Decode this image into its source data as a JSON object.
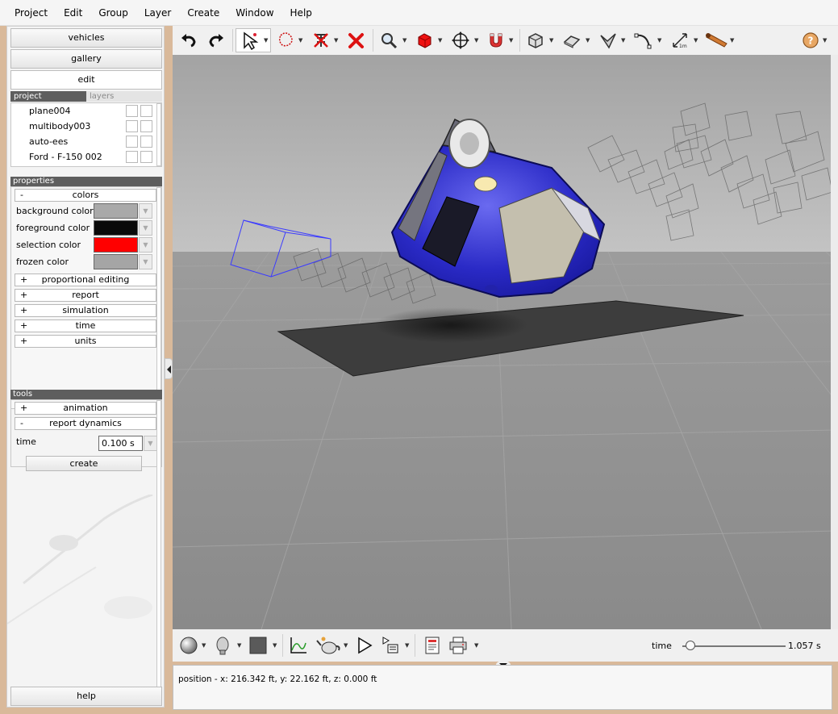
{
  "menu": [
    "Project",
    "Edit",
    "Group",
    "Layer",
    "Create",
    "Window",
    "Help"
  ],
  "nav": {
    "vehicles": "vehicles",
    "gallery": "gallery",
    "edit": "edit",
    "help": "help"
  },
  "project_panel": {
    "tabs": [
      "project",
      "layers"
    ],
    "items": [
      "plane004",
      "multibody003",
      "auto-ees",
      "Ford - F-150 002"
    ]
  },
  "properties": {
    "title": "properties",
    "colors_section": "colors",
    "colors": [
      {
        "label": "background color",
        "color": "#a9a9a9"
      },
      {
        "label": "foreground color",
        "color": "#0a0a0a"
      },
      {
        "label": "selection color",
        "color": "#ff0000"
      },
      {
        "label": "frozen color",
        "color": "#a5a5a5"
      }
    ],
    "sections": [
      "proportional editing",
      "report",
      "simulation",
      "time",
      "units"
    ]
  },
  "tools": {
    "title": "tools",
    "sections": [
      "animation",
      "report dynamics"
    ],
    "time_label": "time",
    "time_value": "0.100 s",
    "create_label": "create"
  },
  "toolbar_icons": [
    "undo-icon",
    "redo-icon",
    "select-icon",
    "lasso-icon",
    "hide-icon",
    "delete-icon",
    "zoom-icon",
    "box-icon",
    "move-icon",
    "magnet-icon",
    "cube-icon",
    "plane-icon",
    "fold-icon",
    "curve-icon",
    "measure-icon",
    "ruler-icon",
    "help-icon"
  ],
  "playback": {
    "time_label": "time",
    "time_value": "1.057 s",
    "time_fraction": 0.08
  },
  "status": {
    "text": "position - x: 216.342 ft, y: 22.162 ft, z: 0.000 ft"
  }
}
